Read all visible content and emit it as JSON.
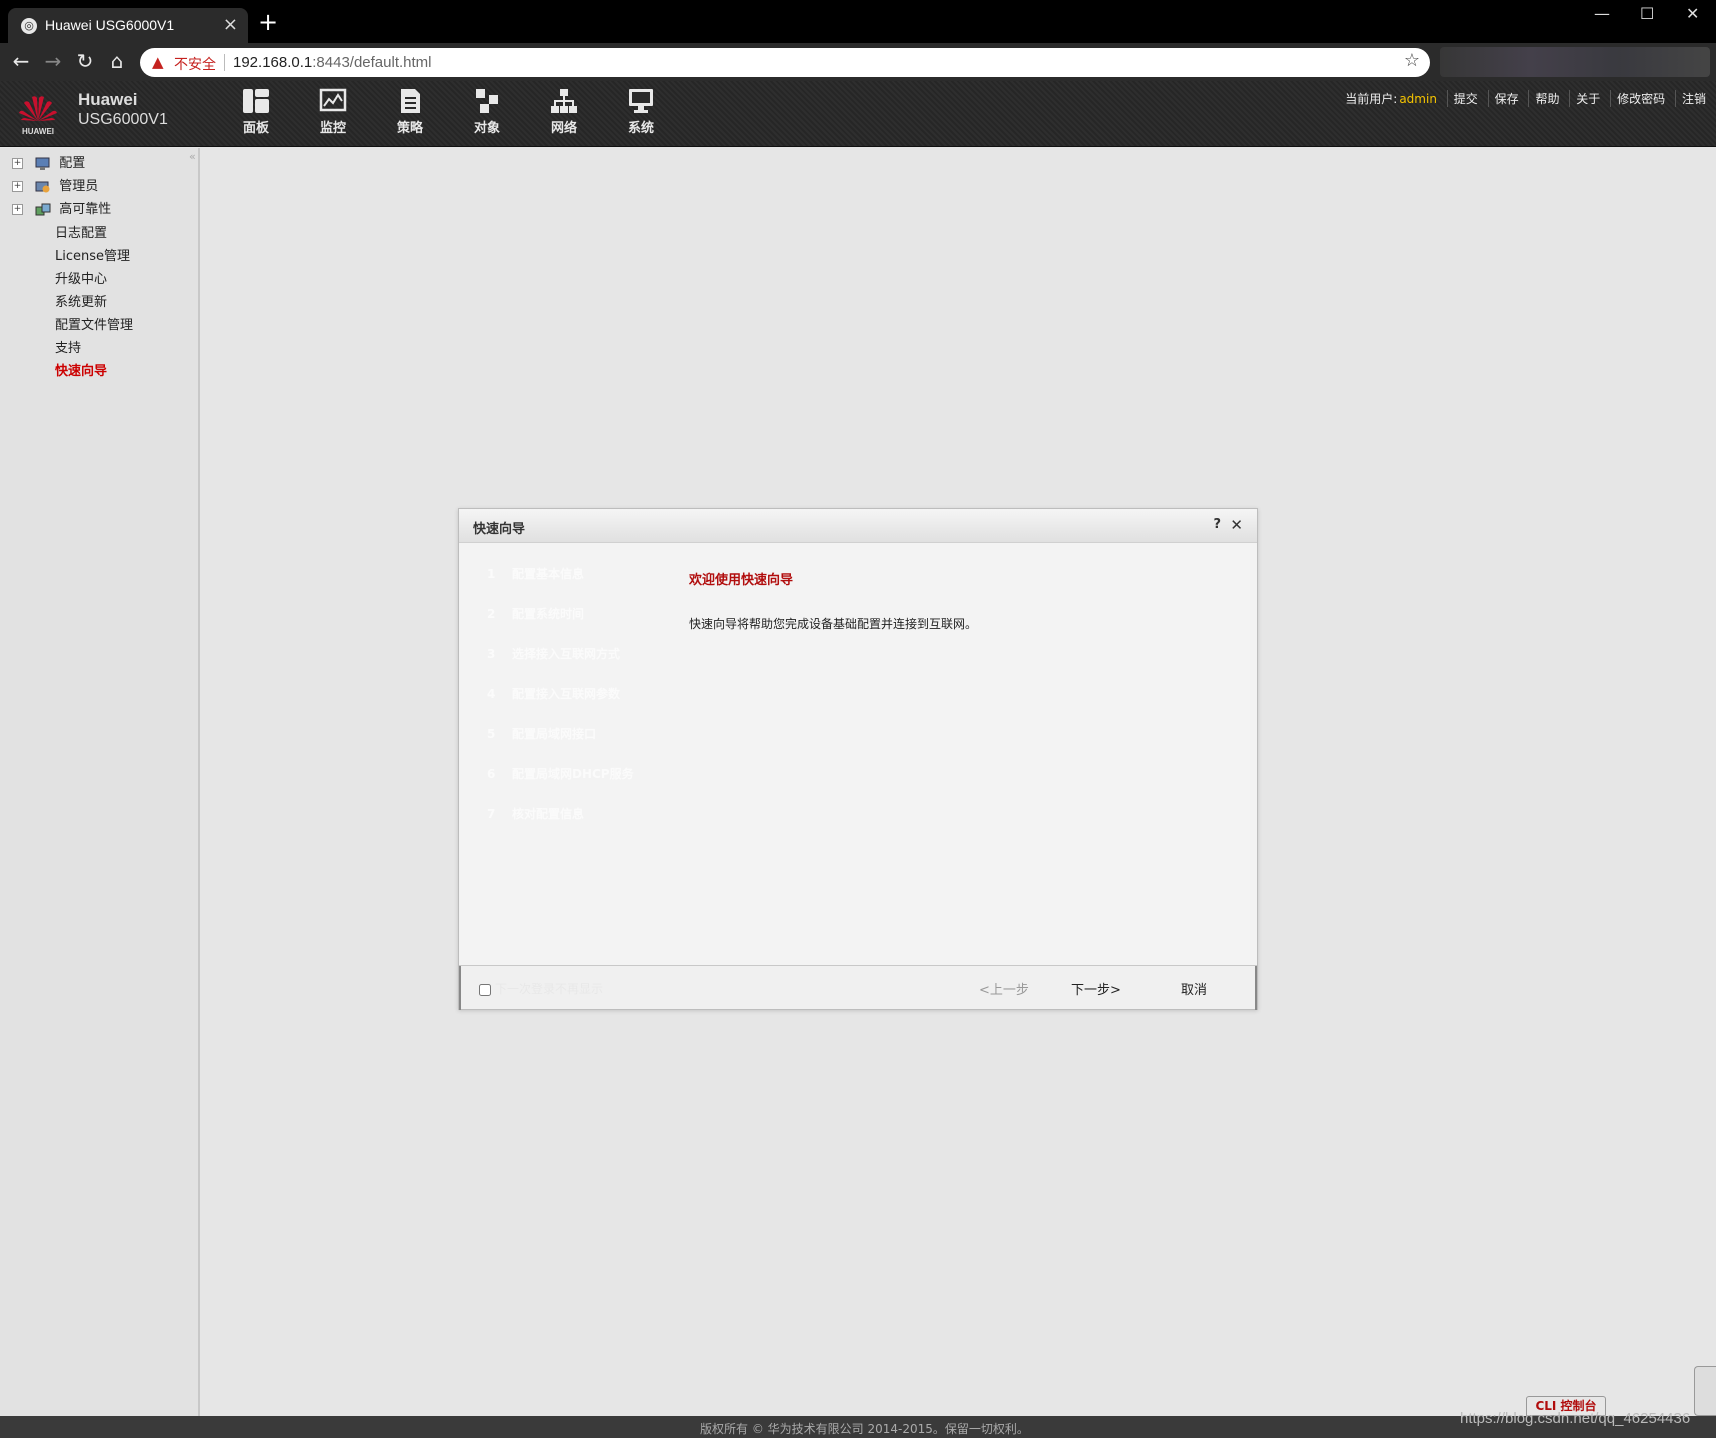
{
  "browser": {
    "tab_title": "Huawei USG6000V1",
    "insecure_label": "不安全",
    "url_host": "192.168.0.1",
    "url_rest": ":8443/default.html"
  },
  "app": {
    "brand_name": "Huawei",
    "brand_model": "USG6000V1",
    "logo_text": "HUAWEI"
  },
  "nav": [
    {
      "label": "面板",
      "icon": "dashboard-icon"
    },
    {
      "label": "监控",
      "icon": "monitor-icon"
    },
    {
      "label": "策略",
      "icon": "policy-icon"
    },
    {
      "label": "对象",
      "icon": "object-icon"
    },
    {
      "label": "网络",
      "icon": "network-icon"
    },
    {
      "label": "系统",
      "icon": "system-icon"
    }
  ],
  "userbar": {
    "current_user_label": "当前用户:",
    "username": "admin",
    "links": [
      "提交",
      "保存",
      "帮助",
      "关于",
      "修改密码",
      "注销"
    ]
  },
  "sidebar": {
    "groups": [
      "配置",
      "管理员",
      "高可靠性"
    ],
    "items": [
      "日志配置",
      "License管理",
      "升级中心",
      "系统更新",
      "配置文件管理",
      "支持",
      "快速向导"
    ],
    "active": "快速向导"
  },
  "dialog": {
    "title": "快速向导",
    "help": "?",
    "close": "✕",
    "steps": [
      {
        "num": "1",
        "label": "配置基本信息"
      },
      {
        "num": "2",
        "label": "配置系统时间"
      },
      {
        "num": "3",
        "label": "选择接入互联网方式"
      },
      {
        "num": "4",
        "label": "配置接入互联网参数"
      },
      {
        "num": "5",
        "label": "配置局域网接口"
      },
      {
        "num": "6",
        "label": "配置局域网DHCP服务"
      },
      {
        "num": "7",
        "label": "核对配置信息"
      }
    ],
    "welcome_title": "欢迎使用快速向导",
    "welcome_desc": "快速向导将帮助您完成设备基础配置并连接到互联网。",
    "dont_show_label": "下一次登录不再显示",
    "prev_label": "<上一步",
    "next_label": "下一步>",
    "cancel_label": "取消"
  },
  "footer": {
    "copyright": "版权所有 © 华为技术有限公司 2014-2015。保留一切权利。",
    "cli_label": "CLI 控制台",
    "watermark": "https://blog.csdn.net/qq_46254436"
  },
  "colors": {
    "accent_red": "#b10d0d",
    "username_yellow": "#f5c400"
  }
}
